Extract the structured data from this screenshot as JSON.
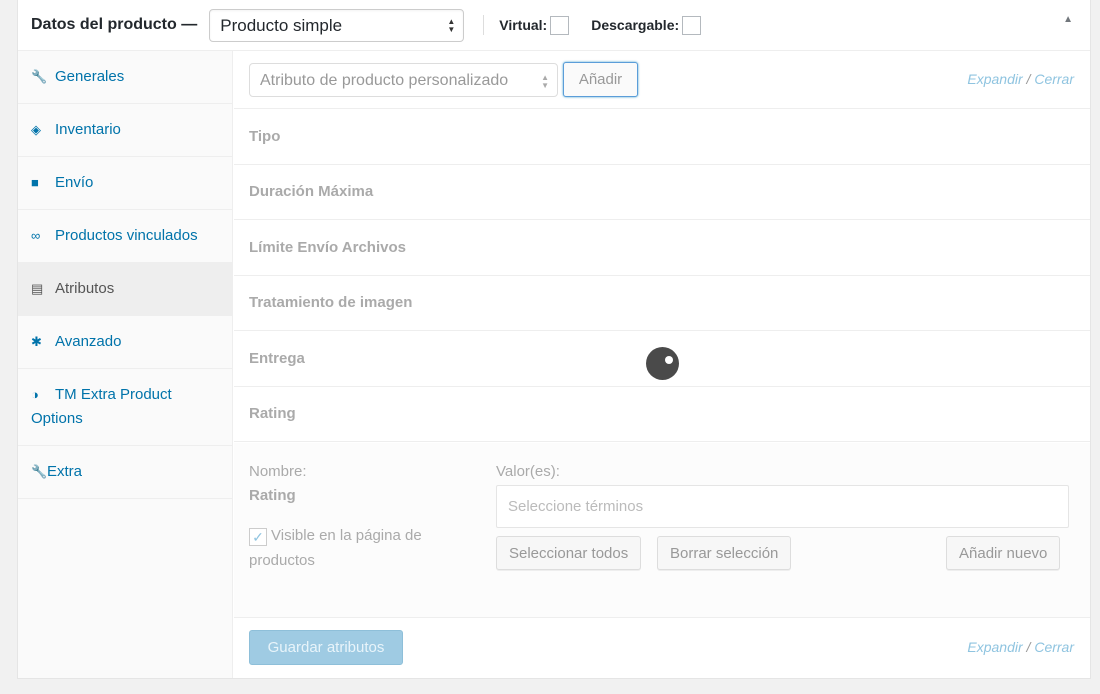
{
  "header": {
    "title": "Datos del producto —",
    "product_type": "Producto simple",
    "virtual_label": "Virtual:",
    "downloadable_label": "Descargable:"
  },
  "tabs": [
    {
      "label": "Generales",
      "icon": "wrench-icon"
    },
    {
      "label": "Inventario",
      "icon": "tag-icon"
    },
    {
      "label": "Envío",
      "icon": "truck-icon"
    },
    {
      "label": "Productos vinculados",
      "icon": "link-icon"
    },
    {
      "label": "Atributos",
      "icon": "list-icon"
    },
    {
      "label": "Avanzado",
      "icon": "gear-icon"
    },
    {
      "label": "TM Extra Product Options",
      "icon": "contrast-icon"
    },
    {
      "label": "Extra",
      "icon": "wrench-icon"
    }
  ],
  "toolbar": {
    "attribute_select": "Atributo de producto personalizado",
    "add_button": "Añadir",
    "expand": "Expandir",
    "slash": " / ",
    "collapse": "Cerrar"
  },
  "attributes": [
    "Tipo",
    "Duración Máxima",
    "Límite Envío Archivos",
    "Tratamiento de imagen",
    "Entrega",
    "Rating"
  ],
  "detail": {
    "name_label": "Nombre:",
    "name_value": "Rating",
    "values_label": "Valor(es):",
    "terms_placeholder": "Seleccione términos",
    "visible_label": "Visible en la página de productos",
    "select_all": "Seleccionar todos",
    "clear_selection": "Borrar selección",
    "add_new": "Añadir nuevo"
  },
  "footer": {
    "save_button": "Guardar atributos"
  }
}
